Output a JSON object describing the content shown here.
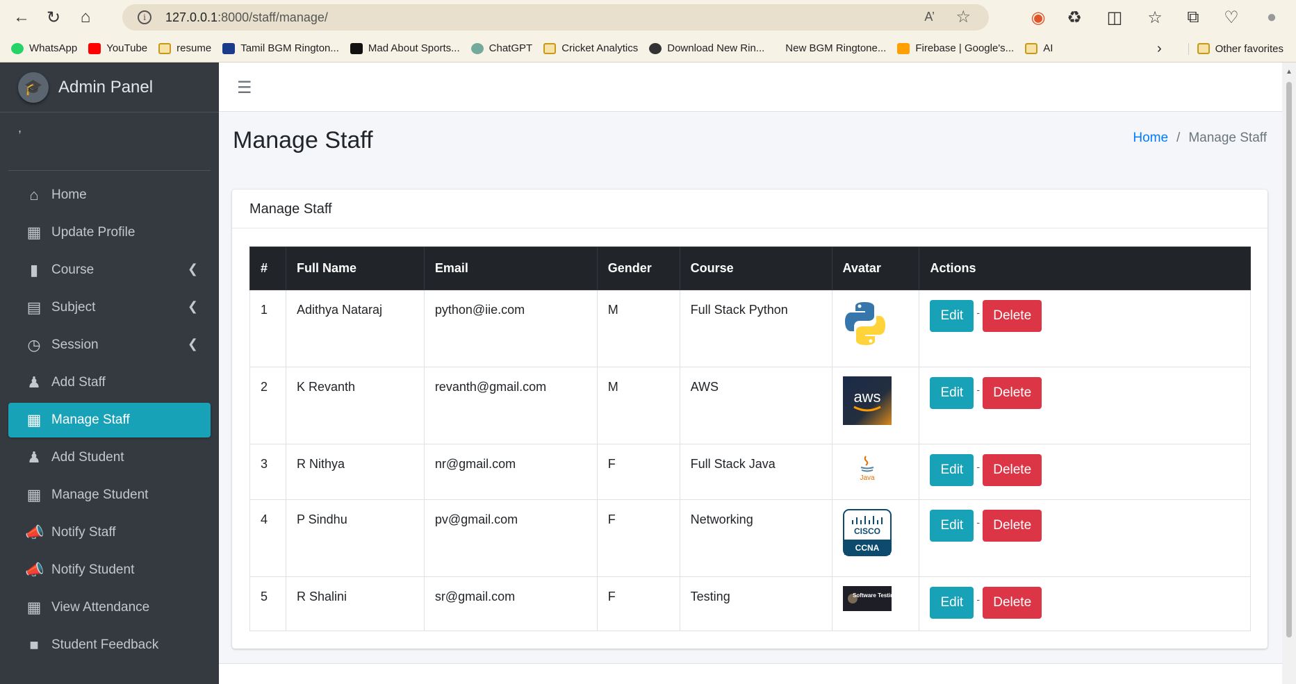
{
  "browser": {
    "url_host": "127.0.0.1",
    "url_path": ":8000/staff/manage/",
    "bookmarks": [
      "WhatsApp",
      "YouTube",
      "resume",
      "Tamil BGM Rington...",
      "Mad About Sports...",
      "ChatGPT",
      "Cricket Analytics",
      "Download New Rin...",
      "New BGM Ringtone...",
      "Firebase | Google's...",
      "AI"
    ],
    "other_favorites": "Other favorites"
  },
  "sidebar": {
    "brand": "Admin Panel",
    "user": ",",
    "items": [
      {
        "label": "Home",
        "icon": "home-icon"
      },
      {
        "label": "Update Profile",
        "icon": "id-card-icon"
      },
      {
        "label": "Course",
        "icon": "bookmark-icon"
      },
      {
        "label": "Subject",
        "icon": "book-icon"
      },
      {
        "label": "Session",
        "icon": "clock-icon"
      },
      {
        "label": "Add Staff",
        "icon": "user-plus-icon"
      },
      {
        "label": "Manage Staff",
        "icon": "grid-icon"
      },
      {
        "label": "Add Student",
        "icon": "user-plus-icon"
      },
      {
        "label": "Manage Student",
        "icon": "grid-icon"
      },
      {
        "label": "Notify Staff",
        "icon": "megaphone-icon"
      },
      {
        "label": "Notify Student",
        "icon": "megaphone-icon"
      },
      {
        "label": "View Attendance",
        "icon": "calendar-icon"
      },
      {
        "label": "Student Feedback",
        "icon": "comment-icon"
      }
    ]
  },
  "page": {
    "title": "Manage Staff",
    "breadcrumb": {
      "home": "Home",
      "sep": "/",
      "current": "Manage Staff"
    },
    "card_title": "Manage Staff"
  },
  "table": {
    "headers": [
      "#",
      "Full Name",
      "Email",
      "Gender",
      "Course",
      "Avatar",
      "Actions"
    ],
    "rows": [
      {
        "num": "1",
        "name": "Adithya Nataraj",
        "email": "python@iie.com",
        "gender": "M",
        "course": "Full Stack Python",
        "avatar": "python-logo"
      },
      {
        "num": "2",
        "name": "K Revanth",
        "email": "revanth@gmail.com",
        "gender": "M",
        "course": "AWS",
        "avatar": "aws-logo"
      },
      {
        "num": "3",
        "name": "R Nithya",
        "email": "nr@gmail.com",
        "gender": "F",
        "course": "Full Stack Java",
        "avatar": "java-logo"
      },
      {
        "num": "4",
        "name": "P Sindhu",
        "email": "pv@gmail.com",
        "gender": "F",
        "course": "Networking",
        "avatar": "cisco-ccna-logo"
      },
      {
        "num": "5",
        "name": "R Shalini",
        "email": "sr@gmail.com",
        "gender": "F",
        "course": "Testing",
        "avatar": "software-testing-logo"
      }
    ],
    "edit_label": "Edit",
    "delete_label": "Delete",
    "separator": "-"
  },
  "logos": {
    "aws": "aws",
    "java": "Java",
    "cisco": "CISCO",
    "ccna": "CCNA",
    "testing": "Software Testing"
  },
  "colors": {
    "sidebar": "#343a40",
    "active": "#17a2b8",
    "edit": "#17a2b8",
    "delete": "#dc3545",
    "link": "#007bff"
  }
}
